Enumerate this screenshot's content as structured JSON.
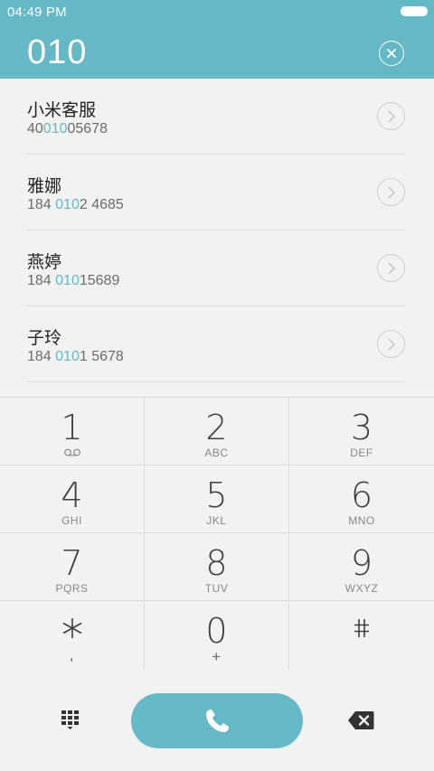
{
  "status_bar": {
    "time": "04:49 PM"
  },
  "dialer": {
    "number": "010"
  },
  "results": [
    {
      "name": "小米客服",
      "number_before": "40",
      "number_match": "010",
      "number_after": "05678"
    },
    {
      "name": "雅娜",
      "number_before": "184 ",
      "number_match": "010",
      "number_after": "2 4685"
    },
    {
      "name": "燕婷",
      "number_before": "184 ",
      "number_match": "010",
      "number_after": "15689"
    },
    {
      "name": "子玲",
      "number_before": "184 ",
      "number_match": "010",
      "number_after": "1 5678"
    }
  ],
  "keypad": [
    {
      "digit": "1",
      "letters": ""
    },
    {
      "digit": "2",
      "letters": "ABC"
    },
    {
      "digit": "3",
      "letters": "DEF"
    },
    {
      "digit": "4",
      "letters": "GHI"
    },
    {
      "digit": "5",
      "letters": "JKL"
    },
    {
      "digit": "6",
      "letters": "MNO"
    },
    {
      "digit": "7",
      "letters": "PQRS"
    },
    {
      "digit": "8",
      "letters": "TUV"
    },
    {
      "digit": "9",
      "letters": "WXYZ"
    },
    {
      "digit": "*",
      "letters": ","
    },
    {
      "digit": "0",
      "letters": "+"
    },
    {
      "digit": "#",
      "letters": ""
    }
  ],
  "icons": {
    "voicemail": "voicemail-icon",
    "clear": "close-icon",
    "detail": "chevron-right-icon",
    "call": "phone-icon",
    "keypad_toggle": "keypad-icon",
    "backspace": "backspace-icon"
  },
  "colors": {
    "accent": "#65b8c6",
    "background": "#f2f2f2",
    "text": "#222222"
  }
}
